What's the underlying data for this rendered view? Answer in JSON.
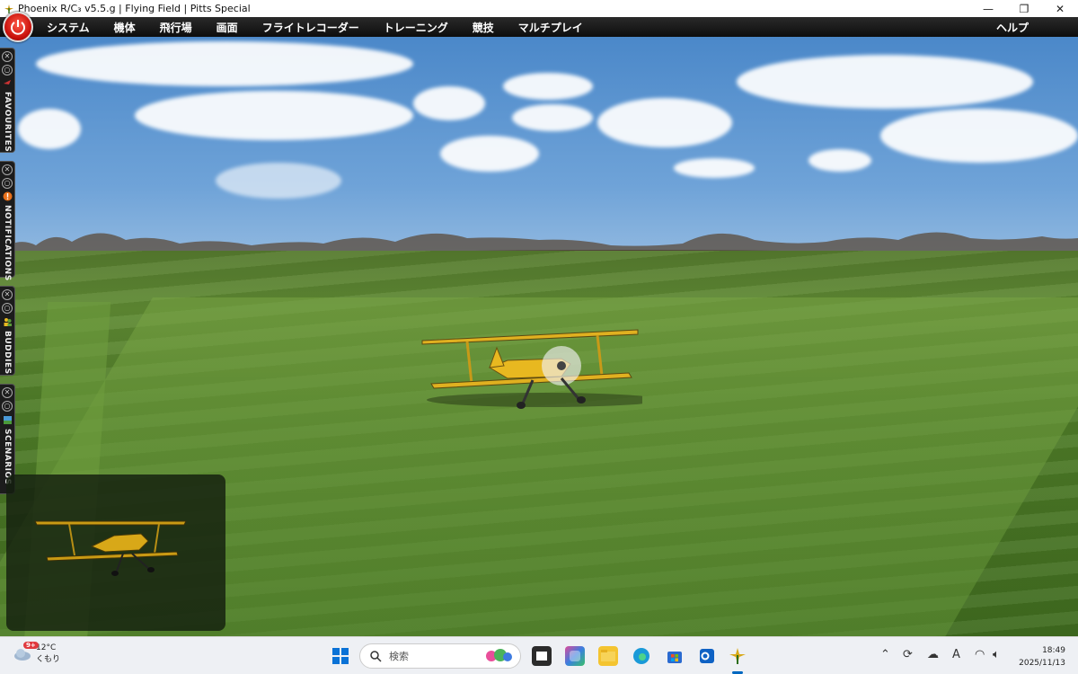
{
  "window": {
    "title": "Phoenix R/C₃ v5.5.g  |  Flying Field  |  Pitts Special",
    "controls": {
      "minimize": "—",
      "restore": "❐",
      "close": "✕"
    }
  },
  "menu": {
    "items": [
      "システム",
      "機体",
      "飛行場",
      "画面",
      "フライトレコーダー",
      "トレーニング",
      "競技",
      "マルチプレイ"
    ],
    "help": "ヘルプ"
  },
  "dock": {
    "tabs": [
      {
        "label": "FAVOURITES",
        "icon": "plane-icon"
      },
      {
        "label": "NOTIFICATIONS",
        "icon": "alert-icon"
      },
      {
        "label": "BUDDIES",
        "icon": "people-icon"
      },
      {
        "label": "SCENARIOS",
        "icon": "scenario-icon"
      }
    ]
  },
  "taskbar": {
    "weather": {
      "temp": "12°C",
      "condition": "くもり",
      "badge": "9+"
    },
    "search_placeholder": "検索",
    "clock": {
      "time": "18:49",
      "date": "2025/11/13"
    },
    "ime": "A"
  },
  "colors": {
    "menu_bg": "#111111",
    "power_red": "#d0140c",
    "grass": "#5f8a33",
    "sky": "#6fa3d8",
    "plane_yellow": "#e8b820"
  }
}
